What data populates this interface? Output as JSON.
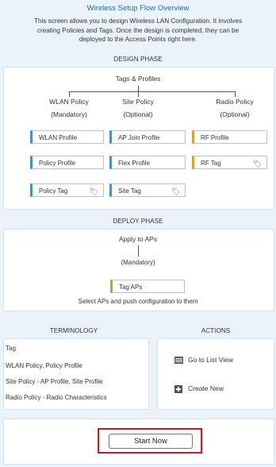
{
  "header": {
    "title": "Wireless Setup Flow Overview",
    "intro": [
      "This screen allows you to design Wireless LAN Configuration. It involves",
      "creating Policies and Tags. Once the design is completed, they can be",
      "deployed to the Access Points right here."
    ]
  },
  "design_phase": {
    "title": "DESIGN PHASE",
    "root": "Tags & Profiles",
    "columns": [
      {
        "label": "WLAN Policy",
        "sub": "(Mandatory)"
      },
      {
        "label": "Site Policy",
        "sub": "(Optional)"
      },
      {
        "label": "Radio Policy",
        "sub": "(Optional)"
      }
    ],
    "buttons": {
      "wlan_profile": "WLAN Profile",
      "ap_join_profile": "AP Join Profile",
      "rf_profile": "RF Profile",
      "policy_profile": "Policy Profile",
      "flex_profile": "Flex Profile",
      "rf_tag": "RF Tag",
      "policy_tag": "Policy Tag",
      "site_tag": "Site Tag"
    },
    "tag_icon_glyph": "🏷"
  },
  "deploy_phase": {
    "title": "DEPLOY PHASE",
    "apply": "Apply to APs",
    "mandatory": "(Mandatory)",
    "tag_aps": "Tag APs",
    "description": "Select APs and push configuration to them"
  },
  "terminology": {
    "title": "TERMINOLOGY",
    "items": [
      "Tag",
      "WLAN Policy, Policy Profile",
      "Site Policy - AP Profile, Site Profile",
      "Radio Policy - Radio Characteristics"
    ]
  },
  "actions": {
    "title": "ACTIONS",
    "list_view": "Go to List View",
    "create_new": "Create New"
  },
  "start_button": "Start Now",
  "colors": {
    "accent_blue": "#4a90c8",
    "accent_yellow": "#e0a030",
    "accent_green": "#9ab82b",
    "highlight_red": "#c8191f",
    "title_blue": "#1a6f9a"
  }
}
